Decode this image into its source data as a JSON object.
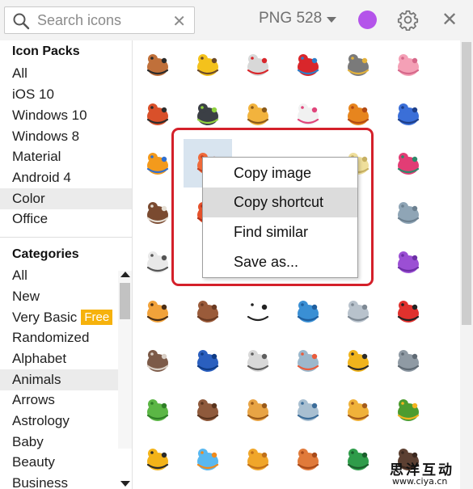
{
  "search": {
    "placeholder": "Search icons",
    "clear_icon": "close-icon"
  },
  "toolbar": {
    "format_label": "PNG 528",
    "color_value": "#b454ea"
  },
  "sidebar": {
    "packs_title": "Icon Packs",
    "packs": [
      "All",
      "iOS 10",
      "Windows 10",
      "Windows 8",
      "Material",
      "Android 4",
      "Color",
      "Office"
    ],
    "selected_pack": "Color",
    "categories_title": "Categories",
    "categories": [
      "All",
      "New",
      "Very Basic",
      "Randomized",
      "Alphabet",
      "Animals",
      "Arrows",
      "Astrology",
      "Baby",
      "Beauty",
      "Business"
    ],
    "free_badge": "Free",
    "selected_category": "Animals"
  },
  "context_menu": {
    "items": [
      "Copy image",
      "Copy shortcut",
      "Find similar",
      "Save as..."
    ],
    "hovered": "Copy shortcut"
  },
  "icons": [
    [
      "dog",
      "canary",
      "hen",
      "parrot",
      "owl",
      "pig"
    ],
    [
      "kennel",
      "cat",
      "beehive",
      "unicorn",
      "lion",
      "butterfly"
    ],
    [
      "clownfish",
      "shrimp",
      "",
      "",
      "bone",
      "hummingbird"
    ],
    [
      "eagle",
      "crab",
      "",
      "",
      "",
      "elephant"
    ],
    [
      "sheep",
      "",
      "",
      "",
      "",
      "octopus"
    ],
    [
      "leopard",
      "paw-print",
      "panda",
      "dolphin",
      "rabbit",
      "ladybug"
    ],
    [
      "wolf",
      "whale",
      "sheep-face",
      "fish-chat",
      "wasp",
      "rhinoceros"
    ],
    [
      "frog",
      "paw",
      "snail",
      "bird-pecking",
      "giraffe",
      "pet-bowl"
    ],
    [
      "bee",
      "fishbowl",
      "seahorse",
      "kangaroo",
      "beetle",
      "gorilla"
    ]
  ],
  "watermark": {
    "cn": "思洋互动",
    "url": "www.ciya.cn"
  }
}
